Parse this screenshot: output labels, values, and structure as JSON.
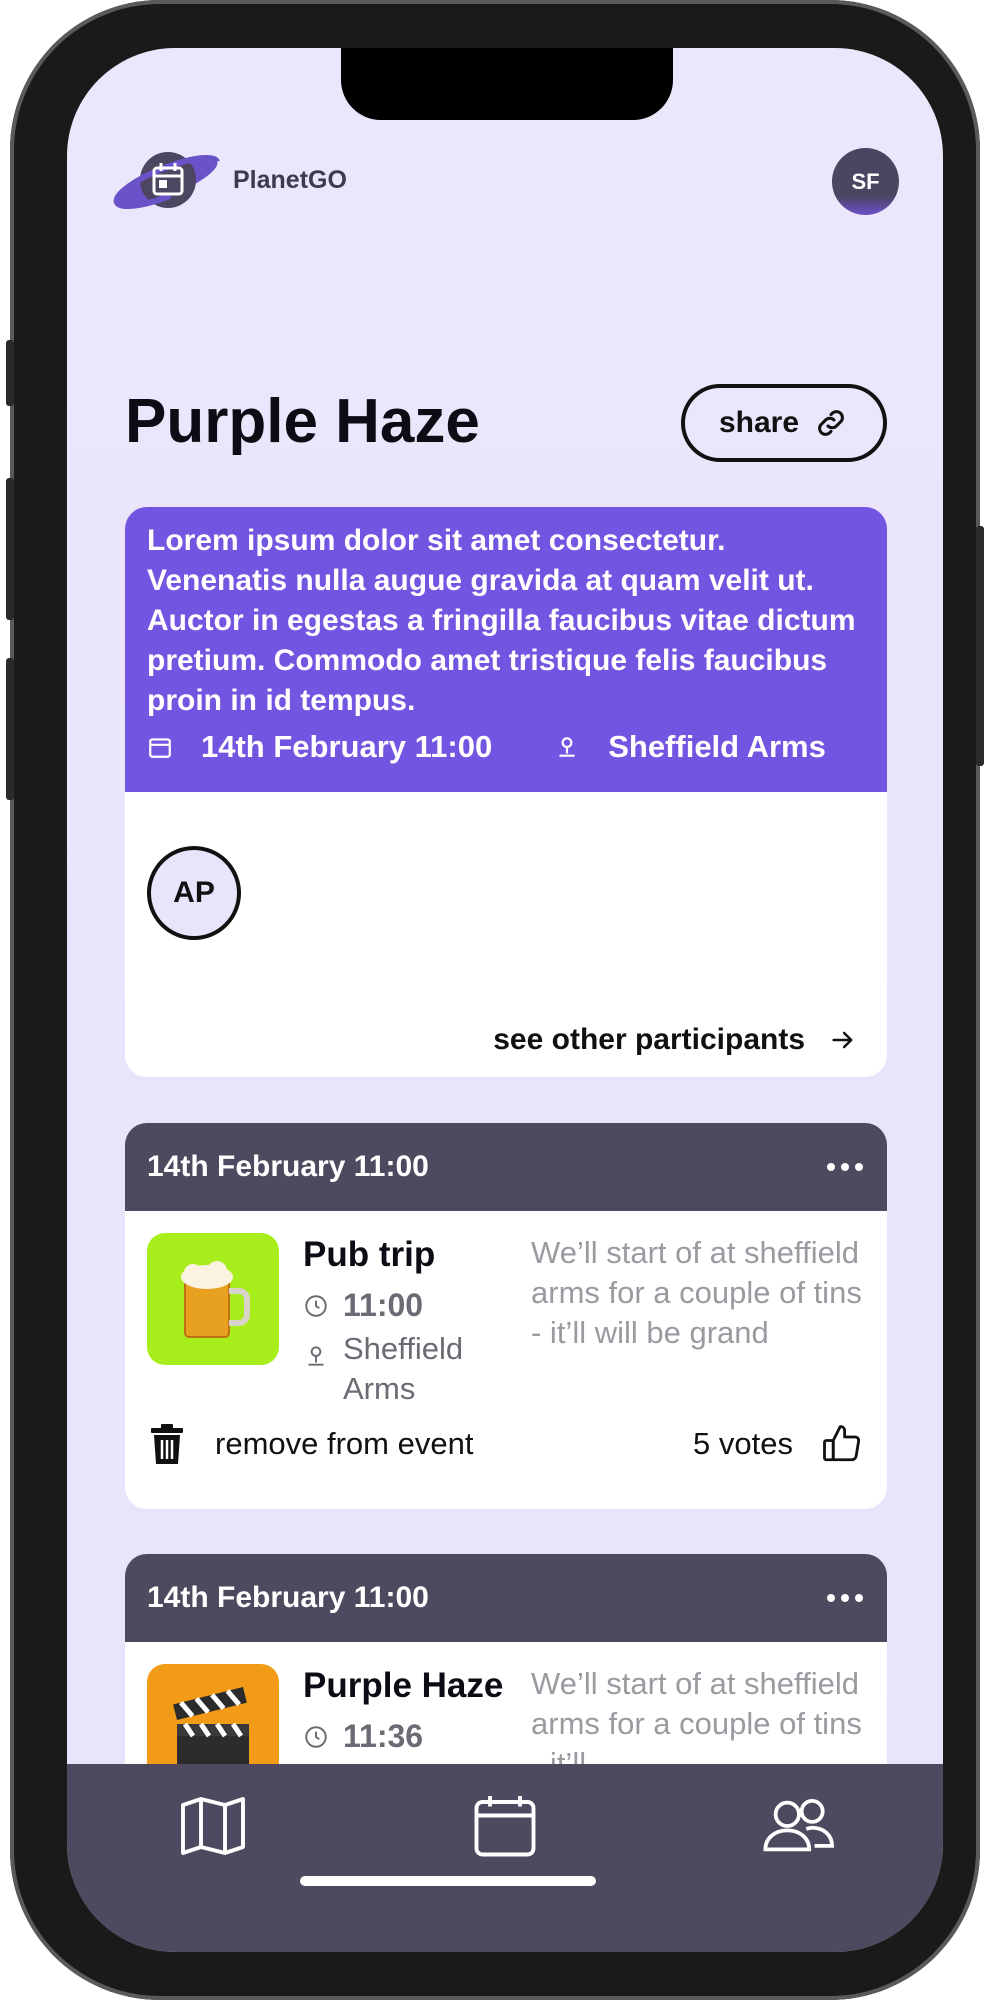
{
  "header": {
    "app_name": "PlanetGO",
    "user_initials": "SF"
  },
  "event": {
    "title": "Purple Haze",
    "share_label": "share",
    "description": "Lorem ipsum dolor sit amet consectetur. Venenatis nulla augue gravida at quam velit ut. Auctor in egestas a fringilla faucibus vitae dictum pretium. Commodo amet tristique felis faucibus proin in id tempus.",
    "date": "14th February 11:00",
    "location": "Sheffield Arms",
    "participant_initials": "AP",
    "see_participants_label": "see other participants"
  },
  "activities": [
    {
      "date": "14th February 11:00",
      "title": "Pub trip",
      "time": "11:00",
      "place_line1": "Sheffield",
      "place_line2": "Arms",
      "description": "We’ll start of at sheffield arms for a couple of tins - it’ll will be grand",
      "remove_label": "remove from event",
      "votes": "5 votes",
      "thumb_color": "#a8ee1c",
      "thumb_icon": "beer-mug-icon"
    },
    {
      "date": "14th February 11:00",
      "title": "Purple Haze",
      "time": "11:36",
      "description": "We’ll start of at sheffield arms for a couple of tins - it’ll",
      "thumb_color": "#f29b16",
      "thumb_icon": "clapperboard-icon"
    }
  ],
  "nav": {
    "items": [
      "map-icon",
      "calendar-icon",
      "people-icon"
    ]
  },
  "colors": {
    "accent": "#7255e0",
    "header_dark": "#4f4960",
    "background": "#e9e5fb"
  }
}
